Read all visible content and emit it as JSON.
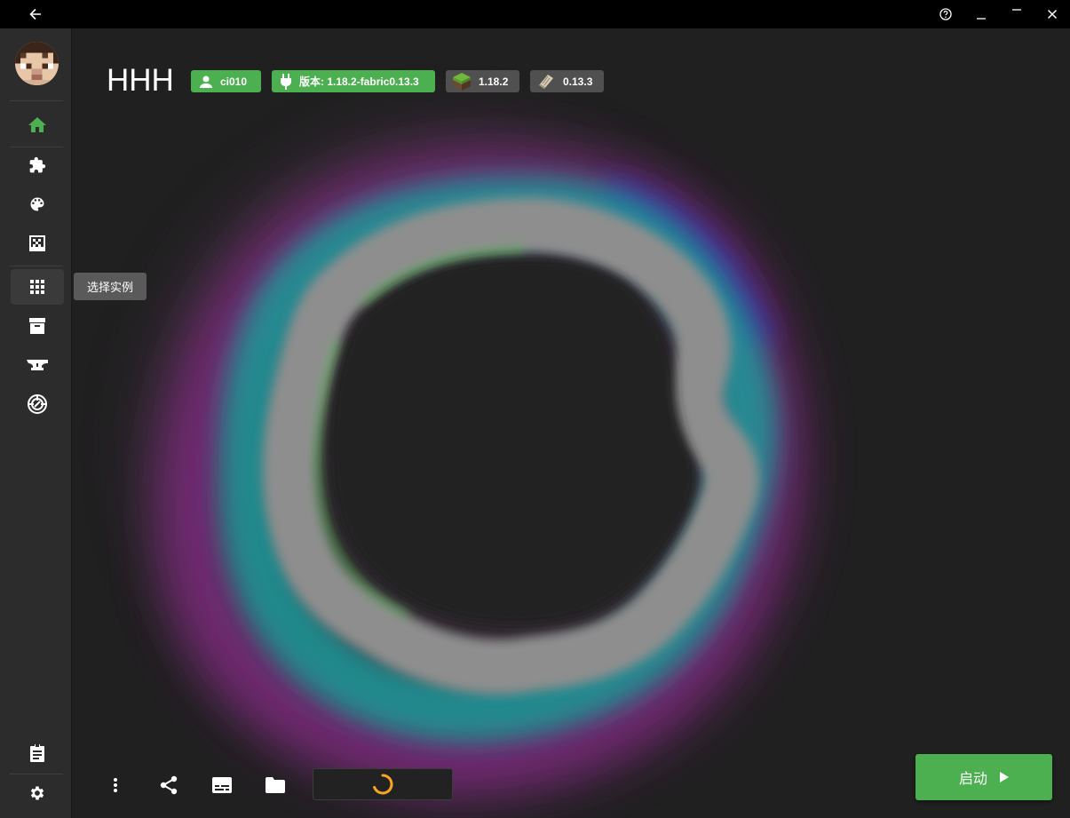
{
  "window": {
    "back_icon": "arrow-left-icon",
    "help_icon": "help-circle-icon",
    "minimize_icon": "minimize-icon",
    "maximize_icon": "maximize-icon",
    "close_icon": "close-icon"
  },
  "sidebar": {
    "avatar_icon": "player-avatar",
    "items": [
      {
        "icon": "home-icon",
        "active": true
      },
      {
        "icon": "puzzle-icon"
      },
      {
        "icon": "palette-icon"
      },
      {
        "icon": "texture-icon"
      },
      {
        "icon": "grid-icon",
        "tooltip": "选择实例"
      },
      {
        "icon": "archive-icon"
      },
      {
        "icon": "anvil-icon"
      },
      {
        "icon": "target-icon"
      },
      {
        "icon": "clipboard-icon"
      },
      {
        "icon": "gear-icon"
      }
    ],
    "tooltip": "选择实例"
  },
  "header": {
    "title": "HHH",
    "badges": [
      {
        "icon": "user-icon",
        "label": "ci010",
        "color": "#4caf50"
      },
      {
        "icon": "plug-icon",
        "label": "版本: 1.18.2-fabric0.13.3",
        "color": "#4caf50"
      },
      {
        "icon": "grass-block-icon",
        "label": "1.18.2",
        "color": "#505050"
      },
      {
        "icon": "fabric-icon",
        "label": "0.13.3",
        "color": "#505050"
      }
    ]
  },
  "toolbar": {
    "more_icon": "more-vertical-icon",
    "share_icon": "share-icon",
    "subtitles_icon": "subtitles-icon",
    "folder_icon": "folder-icon",
    "spinner_icon": "loading-spinner-icon",
    "launch_label": "启动",
    "launch_icon": "play-icon"
  },
  "colors": {
    "accent": "#4caf50",
    "background": "#202020",
    "sidebar": "#2c2c2c"
  }
}
